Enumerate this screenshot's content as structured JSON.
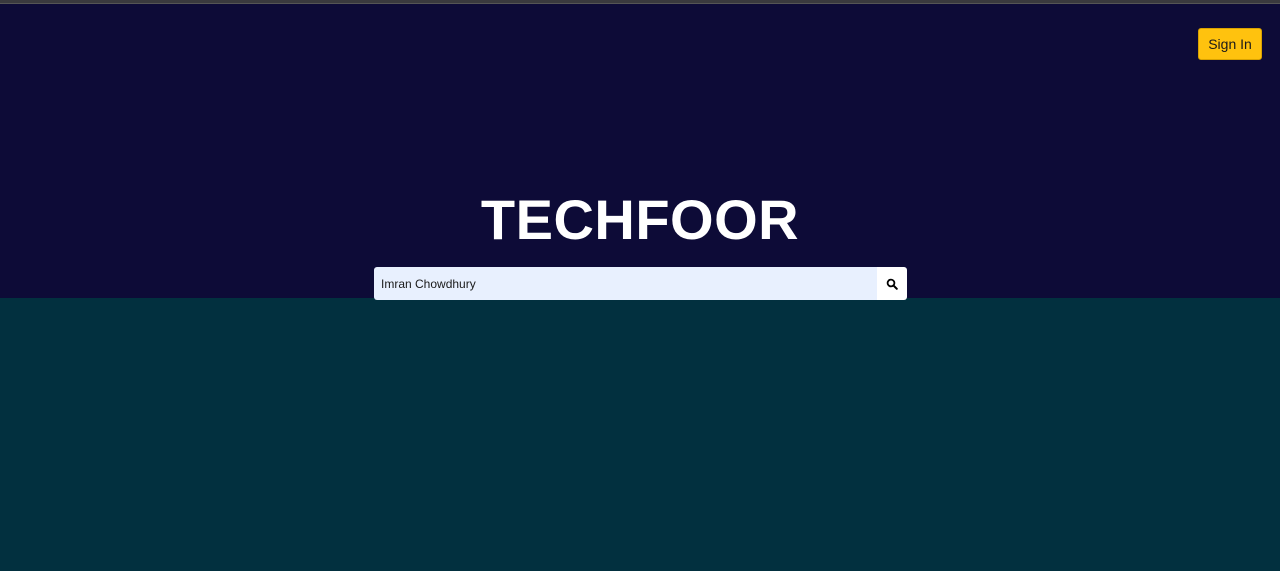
{
  "header": {
    "signin_label": "Sign In"
  },
  "hero": {
    "brand_title": "TECHFOOR"
  },
  "search": {
    "value": "Imran Chowdhury",
    "button_icon": "search-icon"
  },
  "colors": {
    "hero_bg": "#0d0b37",
    "lower_bg": "#02303f",
    "signin_bg": "#ffc20e",
    "search_bg": "#e8f0fe"
  }
}
